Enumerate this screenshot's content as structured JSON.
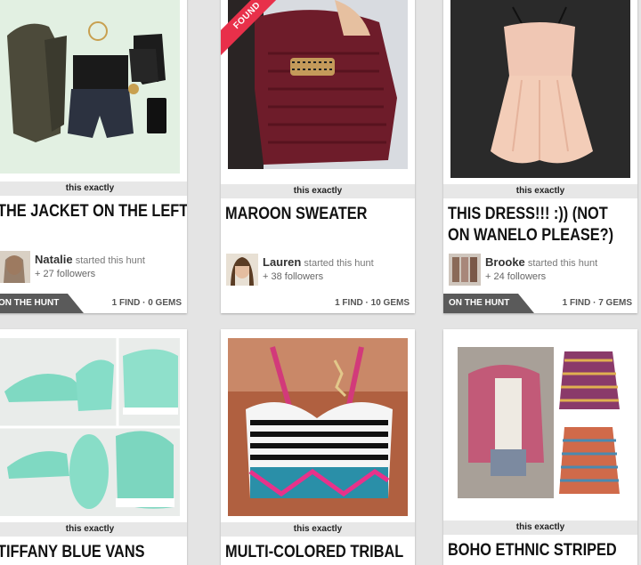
{
  "cards": [
    {
      "tag": "this exactly",
      "title": "THE JACKET ON THE LEFT",
      "hunter_name": "Natalie",
      "hunter_action": "started this hunt",
      "followers": "+ 27 followers",
      "status": "ON THE HUNT",
      "stats": "1 FIND · 0 GEMS"
    },
    {
      "ribbon": "FOUND",
      "tag": "this exactly",
      "title": "MAROON SWEATER",
      "hunter_name": "Lauren",
      "hunter_action": "started this hunt",
      "followers": "+ 38 followers",
      "stats": "1 FIND · 10 GEMS"
    },
    {
      "tag": "this exactly",
      "title_line1": "THIS DRESS!!! :)) (NOT",
      "title_line2": "ON WANELO PLEASE?)",
      "hunter_name": "Brooke",
      "hunter_action": "started this hunt",
      "followers": "+ 24 followers",
      "status": "ON THE HUNT",
      "stats": "1 FIND · 7 GEMS"
    },
    {
      "tag": "this exactly",
      "title": "TIFFANY BLUE VANS"
    },
    {
      "tag": "this exactly",
      "title": "MULTI-COLORED TRIBAL"
    },
    {
      "tag": "this exactly",
      "title": "BOHO ETHNIC STRIPED"
    }
  ]
}
